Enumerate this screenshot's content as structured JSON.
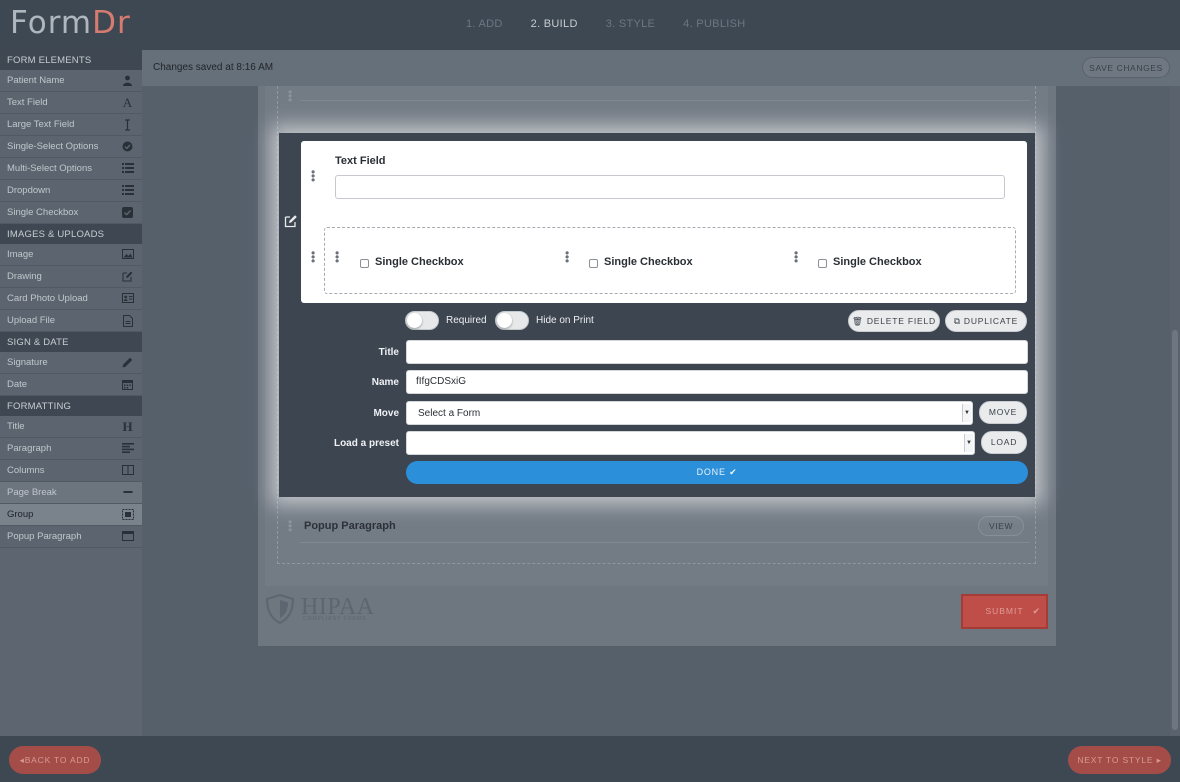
{
  "header": {
    "logo_part1": "Form",
    "logo_part2": "Dr",
    "steps": [
      "1. ADD",
      "2. BUILD",
      "3. STYLE",
      "4. PUBLISH"
    ]
  },
  "sidebar": {
    "sections": [
      {
        "title": "FORM ELEMENTS",
        "items": [
          {
            "label": "Patient Name",
            "icon": "user-icon"
          },
          {
            "label": "Text Field",
            "icon": "font-icon"
          },
          {
            "label": "Large Text Field",
            "icon": "text-cursor-icon"
          },
          {
            "label": "Single-Select Options",
            "icon": "check-circle-icon"
          },
          {
            "label": "Multi-Select Options",
            "icon": "list-icon"
          },
          {
            "label": "Dropdown",
            "icon": "list-icon"
          },
          {
            "label": "Single Checkbox",
            "icon": "checkbox-icon"
          }
        ]
      },
      {
        "title": "IMAGES & UPLOADS",
        "items": [
          {
            "label": "Image",
            "icon": "image-icon"
          },
          {
            "label": "Drawing",
            "icon": "pencil-square-icon"
          },
          {
            "label": "Card Photo Upload",
            "icon": "id-card-icon"
          },
          {
            "label": "Upload File",
            "icon": "file-icon"
          }
        ]
      },
      {
        "title": "SIGN & DATE",
        "items": [
          {
            "label": "Signature",
            "icon": "pen-icon"
          },
          {
            "label": "Date",
            "icon": "calendar-icon"
          }
        ]
      },
      {
        "title": "FORMATTING",
        "items": [
          {
            "label": "Title",
            "icon": "heading-icon"
          },
          {
            "label": "Paragraph",
            "icon": "align-left-icon"
          },
          {
            "label": "Columns",
            "icon": "columns-icon"
          },
          {
            "label": "Page Break",
            "icon": "minus-icon"
          },
          {
            "label": "Group",
            "icon": "group-icon"
          },
          {
            "label": "Popup Paragraph",
            "icon": "window-icon"
          }
        ]
      }
    ]
  },
  "status": {
    "saved_text": "Changes saved at 8:16 AM",
    "save_label": "SAVE CHANGES"
  },
  "editor": {
    "field_label": "Text Field",
    "checkboxes": [
      "Single Checkbox",
      "Single Checkbox",
      "Single Checkbox"
    ],
    "required_label": "Required",
    "hide_print_label": "Hide on Print",
    "delete_label": "DELETE FIELD",
    "duplicate_label": "DUPLICATE",
    "title_label": "Title",
    "title_value": "",
    "name_label": "Name",
    "name_value": "fIfgCDSxiG",
    "move_label": "Move",
    "move_value": "Select a Form",
    "move_btn": "MOVE",
    "preset_label": "Load a preset",
    "preset_value": "",
    "load_btn": "LOAD",
    "done_label": "DONE"
  },
  "form": {
    "popup_title": "Popup Paragraph",
    "view_label": "VIEW",
    "hipaa_text": "HIPAA",
    "hipaa_sub": "COMPLIANT FORMS",
    "submit_label": "SUBMIT"
  },
  "footer": {
    "back_label": "BACK TO ADD",
    "next_label": "NEXT TO STYLE"
  },
  "colors": {
    "accent_blue": "#2b8fd9",
    "brand_red": "#c04e48",
    "topbar": "#3e4853"
  }
}
